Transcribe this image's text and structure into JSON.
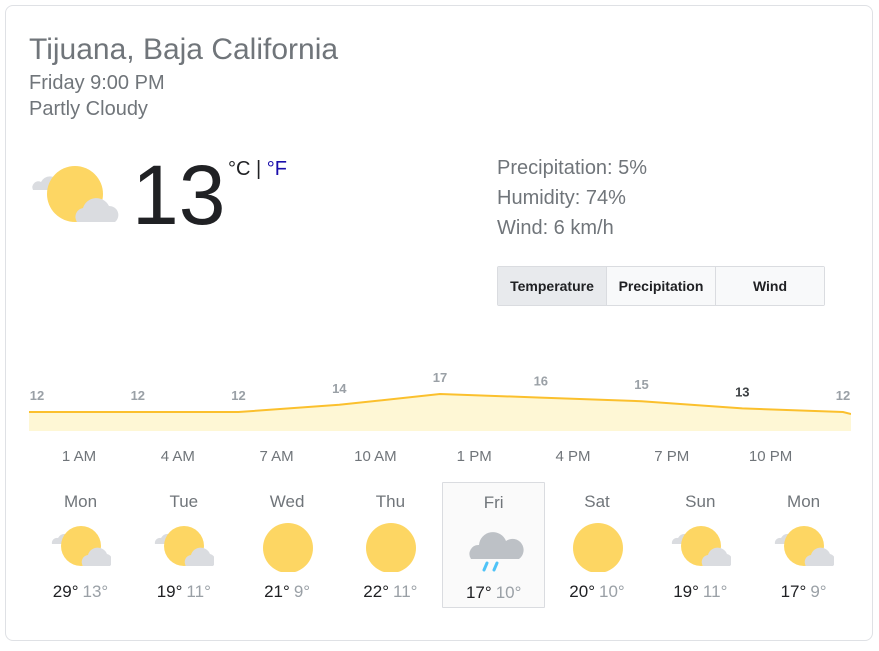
{
  "location": "Tijuana, Baja California",
  "time": "Friday 9:00 PM",
  "condition": "Partly Cloudy",
  "current": {
    "temp": "13",
    "unit_c": "°C",
    "separator": "|",
    "unit_f": "°F",
    "icon": "partly-cloudy-icon"
  },
  "details": {
    "precipitation": "Precipitation: 5%",
    "humidity": "Humidity: 74%",
    "wind": "Wind: 6 km/h"
  },
  "tabs": [
    "Temperature",
    "Precipitation",
    "Wind"
  ],
  "active_tab": "Temperature",
  "chart_data": {
    "type": "area",
    "values": [
      12,
      12,
      12,
      14,
      17,
      16,
      15,
      13,
      12
    ],
    "value_labels": [
      "12",
      "12",
      "12",
      "14",
      "17",
      "16",
      "15",
      "13",
      "12"
    ],
    "highlighted_label_index": 7,
    "x_labels": [
      "1 AM",
      "4 AM",
      "7 AM",
      "10 AM",
      "1 PM",
      "4 PM",
      "7 PM",
      "10 PM"
    ],
    "line_color": "#fbc02d",
    "fill_color": "#fef7d5"
  },
  "days": [
    {
      "name": "Mon",
      "icon": "partly-cloudy-icon",
      "hi": "29°",
      "lo": "13°"
    },
    {
      "name": "Tue",
      "icon": "partly-cloudy-icon",
      "hi": "19°",
      "lo": "11°"
    },
    {
      "name": "Wed",
      "icon": "sunny-icon",
      "hi": "21°",
      "lo": "9°"
    },
    {
      "name": "Thu",
      "icon": "sunny-icon",
      "hi": "22°",
      "lo": "11°"
    },
    {
      "name": "Fri",
      "icon": "rain-icon",
      "hi": "17°",
      "lo": "10°"
    },
    {
      "name": "Sat",
      "icon": "sunny-icon",
      "hi": "20°",
      "lo": "10°"
    },
    {
      "name": "Sun",
      "icon": "partly-cloudy-icon",
      "hi": "19°",
      "lo": "11°"
    },
    {
      "name": "Mon",
      "icon": "partly-cloudy-icon",
      "hi": "17°",
      "lo": "9°"
    }
  ],
  "selected_day_index": 4
}
